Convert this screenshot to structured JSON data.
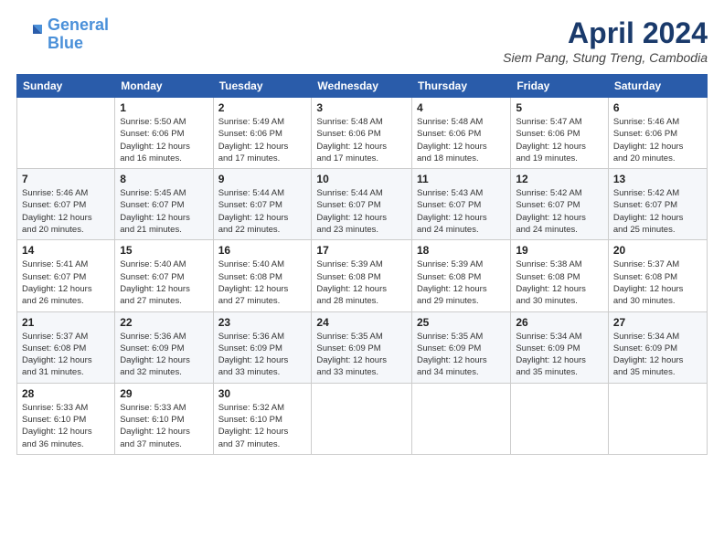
{
  "header": {
    "logo_line1": "General",
    "logo_line2": "Blue",
    "main_title": "April 2024",
    "subtitle": "Siem Pang, Stung Treng, Cambodia"
  },
  "weekdays": [
    "Sunday",
    "Monday",
    "Tuesday",
    "Wednesday",
    "Thursday",
    "Friday",
    "Saturday"
  ],
  "weeks": [
    [
      {
        "day": "",
        "info": ""
      },
      {
        "day": "1",
        "info": "Sunrise: 5:50 AM\nSunset: 6:06 PM\nDaylight: 12 hours\nand 16 minutes."
      },
      {
        "day": "2",
        "info": "Sunrise: 5:49 AM\nSunset: 6:06 PM\nDaylight: 12 hours\nand 17 minutes."
      },
      {
        "day": "3",
        "info": "Sunrise: 5:48 AM\nSunset: 6:06 PM\nDaylight: 12 hours\nand 17 minutes."
      },
      {
        "day": "4",
        "info": "Sunrise: 5:48 AM\nSunset: 6:06 PM\nDaylight: 12 hours\nand 18 minutes."
      },
      {
        "day": "5",
        "info": "Sunrise: 5:47 AM\nSunset: 6:06 PM\nDaylight: 12 hours\nand 19 minutes."
      },
      {
        "day": "6",
        "info": "Sunrise: 5:46 AM\nSunset: 6:06 PM\nDaylight: 12 hours\nand 20 minutes."
      }
    ],
    [
      {
        "day": "7",
        "info": "Sunrise: 5:46 AM\nSunset: 6:07 PM\nDaylight: 12 hours\nand 20 minutes."
      },
      {
        "day": "8",
        "info": "Sunrise: 5:45 AM\nSunset: 6:07 PM\nDaylight: 12 hours\nand 21 minutes."
      },
      {
        "day": "9",
        "info": "Sunrise: 5:44 AM\nSunset: 6:07 PM\nDaylight: 12 hours\nand 22 minutes."
      },
      {
        "day": "10",
        "info": "Sunrise: 5:44 AM\nSunset: 6:07 PM\nDaylight: 12 hours\nand 23 minutes."
      },
      {
        "day": "11",
        "info": "Sunrise: 5:43 AM\nSunset: 6:07 PM\nDaylight: 12 hours\nand 24 minutes."
      },
      {
        "day": "12",
        "info": "Sunrise: 5:42 AM\nSunset: 6:07 PM\nDaylight: 12 hours\nand 24 minutes."
      },
      {
        "day": "13",
        "info": "Sunrise: 5:42 AM\nSunset: 6:07 PM\nDaylight: 12 hours\nand 25 minutes."
      }
    ],
    [
      {
        "day": "14",
        "info": "Sunrise: 5:41 AM\nSunset: 6:07 PM\nDaylight: 12 hours\nand 26 minutes."
      },
      {
        "day": "15",
        "info": "Sunrise: 5:40 AM\nSunset: 6:07 PM\nDaylight: 12 hours\nand 27 minutes."
      },
      {
        "day": "16",
        "info": "Sunrise: 5:40 AM\nSunset: 6:08 PM\nDaylight: 12 hours\nand 27 minutes."
      },
      {
        "day": "17",
        "info": "Sunrise: 5:39 AM\nSunset: 6:08 PM\nDaylight: 12 hours\nand 28 minutes."
      },
      {
        "day": "18",
        "info": "Sunrise: 5:39 AM\nSunset: 6:08 PM\nDaylight: 12 hours\nand 29 minutes."
      },
      {
        "day": "19",
        "info": "Sunrise: 5:38 AM\nSunset: 6:08 PM\nDaylight: 12 hours\nand 30 minutes."
      },
      {
        "day": "20",
        "info": "Sunrise: 5:37 AM\nSunset: 6:08 PM\nDaylight: 12 hours\nand 30 minutes."
      }
    ],
    [
      {
        "day": "21",
        "info": "Sunrise: 5:37 AM\nSunset: 6:08 PM\nDaylight: 12 hours\nand 31 minutes."
      },
      {
        "day": "22",
        "info": "Sunrise: 5:36 AM\nSunset: 6:09 PM\nDaylight: 12 hours\nand 32 minutes."
      },
      {
        "day": "23",
        "info": "Sunrise: 5:36 AM\nSunset: 6:09 PM\nDaylight: 12 hours\nand 33 minutes."
      },
      {
        "day": "24",
        "info": "Sunrise: 5:35 AM\nSunset: 6:09 PM\nDaylight: 12 hours\nand 33 minutes."
      },
      {
        "day": "25",
        "info": "Sunrise: 5:35 AM\nSunset: 6:09 PM\nDaylight: 12 hours\nand 34 minutes."
      },
      {
        "day": "26",
        "info": "Sunrise: 5:34 AM\nSunset: 6:09 PM\nDaylight: 12 hours\nand 35 minutes."
      },
      {
        "day": "27",
        "info": "Sunrise: 5:34 AM\nSunset: 6:09 PM\nDaylight: 12 hours\nand 35 minutes."
      }
    ],
    [
      {
        "day": "28",
        "info": "Sunrise: 5:33 AM\nSunset: 6:10 PM\nDaylight: 12 hours\nand 36 minutes."
      },
      {
        "day": "29",
        "info": "Sunrise: 5:33 AM\nSunset: 6:10 PM\nDaylight: 12 hours\nand 37 minutes."
      },
      {
        "day": "30",
        "info": "Sunrise: 5:32 AM\nSunset: 6:10 PM\nDaylight: 12 hours\nand 37 minutes."
      },
      {
        "day": "",
        "info": ""
      },
      {
        "day": "",
        "info": ""
      },
      {
        "day": "",
        "info": ""
      },
      {
        "day": "",
        "info": ""
      }
    ]
  ]
}
